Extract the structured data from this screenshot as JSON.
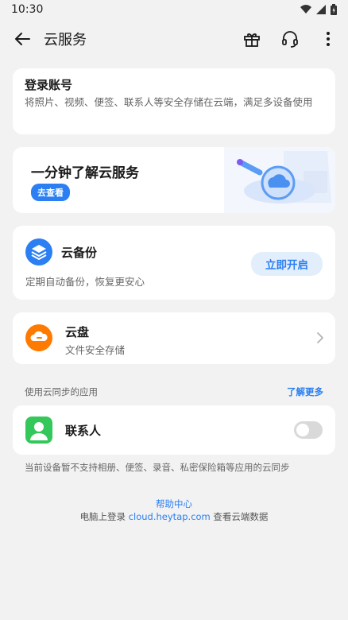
{
  "status": {
    "time": "10:30"
  },
  "nav": {
    "title": "云服务"
  },
  "login": {
    "title": "登录账号",
    "description": "将照片、视频、便签、联系人等安全存储在云端，满足多设备使用"
  },
  "promo": {
    "title": "一分钟了解云服务",
    "button": "去查看"
  },
  "backup": {
    "title": "云备份",
    "description": "定期自动备份，恢复更安心",
    "button": "立即开启"
  },
  "drive": {
    "title": "云盘",
    "description": "文件安全存储"
  },
  "sync_section": {
    "label": "使用云同步的应用",
    "more": "了解更多"
  },
  "contacts": {
    "title": "联系人",
    "toggle_on": false
  },
  "note": "当前设备暂不支持相册、便签、录音、私密保险箱等应用的云同步",
  "help": "帮助中心",
  "footer": {
    "prefix": "电脑上登录 ",
    "link": "cloud.heytap.com",
    "suffix": " 查看云端数据"
  },
  "icons": {
    "back": "arrow-left-icon",
    "gift": "gift-icon",
    "headset": "headset-icon",
    "more": "more-vertical-icon",
    "backup": "layers-icon",
    "drive": "cloud-icon",
    "contacts": "person-icon"
  },
  "colors": {
    "accent": "#2b7ff2",
    "backup_icon": "#2b7ff2",
    "drive_icon": "#ff7a00",
    "contacts_icon": "#34c759"
  }
}
